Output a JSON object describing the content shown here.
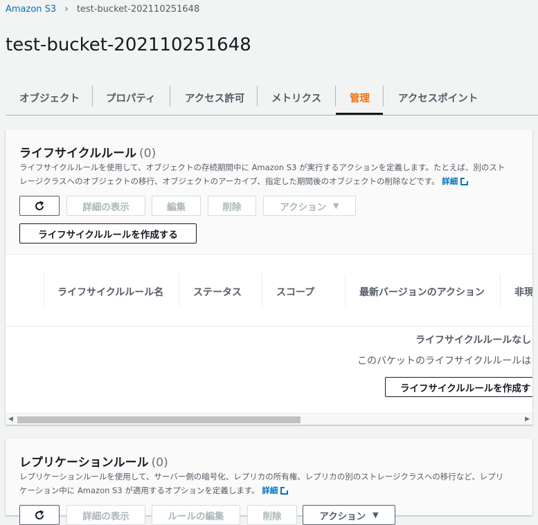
{
  "breadcrumb": {
    "root": "Amazon S3",
    "separator": "›",
    "current": "test-bucket-202110251648"
  },
  "page_title": "test-bucket-202110251648",
  "tabs": [
    {
      "label": "オブジェクト"
    },
    {
      "label": "プロパティ"
    },
    {
      "label": "アクセス許可"
    },
    {
      "label": "メトリクス"
    },
    {
      "label": "管理",
      "active": true
    },
    {
      "label": "アクセスポイント"
    }
  ],
  "lifecycle": {
    "title": "ライフサイクルルール",
    "count": "(0)",
    "description": "ライフサイクルルールを使用して、オブジェクトの存続期間中に Amazon S3 が実行するアクションを定義します。たとえば、別のストレージクラスへのオブジェクトの移行、オブジェクトのアーカイブ、指定した期間後のオブジェクトの削除などです。",
    "info_link": "詳細",
    "buttons": {
      "refresh_icon": "refresh-icon",
      "details": "詳細の表示",
      "edit": "編集",
      "delete": "削除",
      "actions": "アクション",
      "create": "ライフサイクルルールを作成する"
    },
    "table": {
      "columns": [
        "ライフサイクルルール名",
        "ステータス",
        "スコープ",
        "最新バージョンのアクション",
        "非現"
      ],
      "empty_title": "ライフサイクルルールなし",
      "empty_text": "このバケットのライフサイクルルールは",
      "empty_button": "ライフサイクルルールを作成す"
    }
  },
  "replication": {
    "title": "レプリケーションルール",
    "count": "(0)",
    "description": "レプリケーションルールを使用して、サーバー側の暗号化、レプリカの所有権、レプリカの別のストレージクラスへの移行など、レプリケーション中に Amazon S3 が適用するオプションを定義します。",
    "info_link": "詳細",
    "buttons": {
      "details": "詳細の表示",
      "edit": "ルールの編集",
      "delete": "削除",
      "actions": "アクション"
    }
  }
}
